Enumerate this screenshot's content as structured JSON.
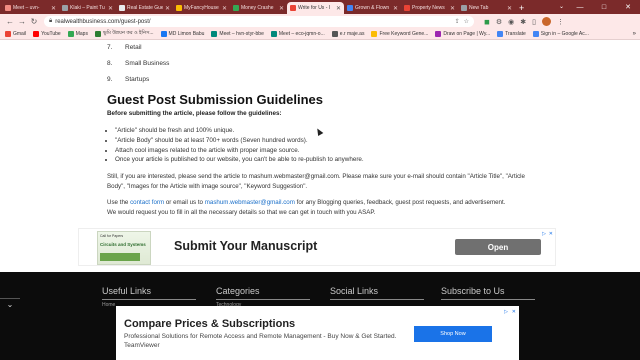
{
  "tabs": [
    {
      "label": "Meet – uvn-",
      "color": "#f28b82",
      "active": false
    },
    {
      "label": "Klaki – Paint Tu",
      "color": "#9aa0a6",
      "active": false
    },
    {
      "label": "Real Estate Gue",
      "color": "#e8eaed",
      "active": false
    },
    {
      "label": "MyFancyHouse",
      "color": "#fbbc04",
      "active": false
    },
    {
      "label": "Money Crashe",
      "color": "#34a853",
      "active": false
    },
    {
      "label": "Write for Us - I",
      "color": "#ea4335",
      "active": true
    },
    {
      "label": "Grown & Flown",
      "color": "#4285f4",
      "active": false
    },
    {
      "label": "Property News",
      "color": "#ea4335",
      "active": false
    },
    {
      "label": "New Tab",
      "color": "#9aa0a6",
      "active": false
    }
  ],
  "window": {
    "new_tab": "+",
    "minimize": "—",
    "maximize": "□",
    "close": "✕"
  },
  "toolbar": {
    "url": "realwealthbusiness.com/guest-post/"
  },
  "bookmarks": [
    {
      "label": "Gmail",
      "color": "#ea4335"
    },
    {
      "label": "YouTube",
      "color": "#ff0000"
    },
    {
      "label": "Maps",
      "color": "#34a853"
    },
    {
      "label": "ভুমি উন্নয়ন কর ও ইনিস...",
      "color": "#2e7d32"
    },
    {
      "label": "MD Limon Babu",
      "color": "#1877f2"
    },
    {
      "label": "Meet – hvn-styr-bbe",
      "color": "#00897b"
    },
    {
      "label": "Meet – eco-jqmn-o...",
      "color": "#00897b"
    },
    {
      "label": "e.r maje.as",
      "color": "#555555"
    },
    {
      "label": "Free Keyword Gene...",
      "color": "#fbbc04"
    },
    {
      "label": "Draw on Page | Wy...",
      "color": "#9c27b0"
    },
    {
      "label": "Translate",
      "color": "#4285f4"
    },
    {
      "label": "Sign in – Google Ac...",
      "color": "#4285f4"
    }
  ],
  "article": {
    "list": [
      {
        "num": "7.",
        "label": "Retail"
      },
      {
        "num": "8.",
        "label": "Small Business"
      },
      {
        "num": "9.",
        "label": "Startups"
      }
    ],
    "heading": "Guest Post Submission Guidelines",
    "lead": "Before submitting the article, please follow the guidelines:",
    "bullets": [
      "\"Article\" should be fresh and 100% unique.",
      "\"Article Body\" should be at least 700+ words (Seven hundred words).",
      "Attach cool images related to the article with proper image source.",
      "Once your article is published to our website, you can't be able to re-publish to anywhere."
    ],
    "para1": "Still, if you are interested, please send the article to mashum.webmaster@gmail.com. Please make sure your e-mail should contain \"Article Title\", \"Article Body\", \"Images for the Article with image source\", \"Keyword Suggestion\".",
    "para2_a": "Use the",
    "contact_link": "contact form",
    "para2_b": "or email us to",
    "email_link": "mashum.webmaster@gmail.com",
    "para2_c": "for any Blogging queries, feedback, guest post requests, and advertisement.",
    "para3": "We would request you to fill in all the necessary details so that we can get in touch with you ASAP."
  },
  "ad1": {
    "thumb_top": "Call for Papers",
    "thumb_title": "Circuits and Systems",
    "headline": "Submit Your Manuscript",
    "cta": "Open"
  },
  "footer": {
    "col1": "Useful Links",
    "col1_sub": "Home",
    "col2": "Categories",
    "col2_sub": "Technology",
    "col3": "Social Links",
    "col4": "Subscribe to Us"
  },
  "ad2": {
    "title": "Compare Prices & Subscriptions",
    "desc": "Professional Solutions for Remote Access and Remote Management - Buy Now & Get Started. TeamViewer",
    "cta": "Shop Now"
  },
  "ad_marks": {
    "info": "▷",
    "close": "✕"
  }
}
